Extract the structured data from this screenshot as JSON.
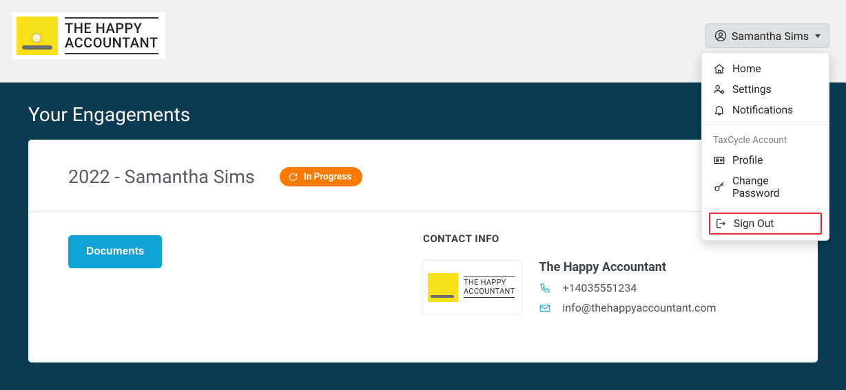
{
  "logo": {
    "line1": "THE HAPPY",
    "line2": "ACCOUNTANT"
  },
  "user": {
    "name": "Samantha Sims"
  },
  "dropdown": {
    "home": "Home",
    "settings": "Settings",
    "notifications": "Notifications",
    "section_header": "TaxCycle Account",
    "profile": "Profile",
    "change_password": "Change Password",
    "sign_out": "Sign Out"
  },
  "page_title": "Your Engagements",
  "engagement": {
    "title": "2022 - Samantha Sims",
    "status": "In Progress"
  },
  "documents_btn": "Documents",
  "contact": {
    "section_label": "CONTACT INFO",
    "name": "The Happy Accountant",
    "phone": "+14035551234",
    "email": "info@thehappyaccountant.com",
    "logo_line1": "THE HAPPY",
    "logo_line2": "ACCOUNTANT"
  }
}
